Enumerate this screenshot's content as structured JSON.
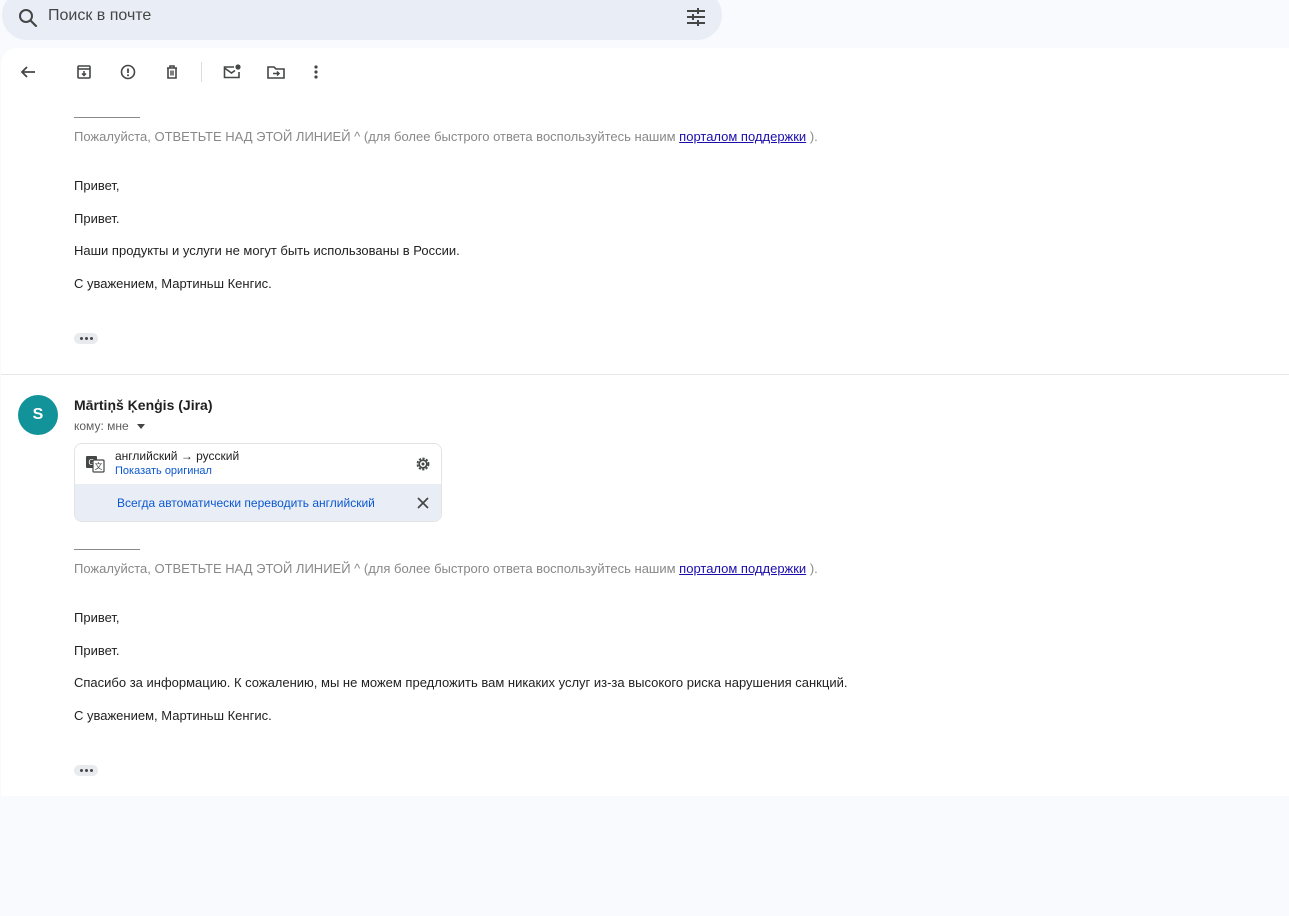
{
  "search": {
    "placeholder": "Поиск в почте"
  },
  "toolbar": {
    "back": "arrow-back-icon",
    "archive": "archive-icon",
    "spam": "report-spam-icon",
    "delete": "delete-icon",
    "mark_unread": "mark-unread-icon",
    "move": "move-to-icon",
    "more": "more-vertical-icon"
  },
  "message1": {
    "notice_prefix": "Пожалуйста, ОТВЕТЬТЕ НАД ЭТОЙ ЛИНИЕЙ ^ (для более быстрого ответа воспользуйтесь нашим ",
    "notice_link": "порталом поддержки",
    "notice_suffix": " ).",
    "lines": [
      "Привет,",
      "Привет.",
      "Наши продукты и услуги не могут быть использованы в России.",
      "С уважением, Мартиньш Кенгис."
    ]
  },
  "message2": {
    "avatar_letter": "S",
    "sender": "Mārtiņš Ķenģis (Jira)",
    "to": "кому: мне",
    "translation": {
      "langs": "английский → русский",
      "show_original": "Показать оригинал",
      "always_translate": "Всегда автоматически переводить английский"
    },
    "notice_prefix": "Пожалуйста, ОТВЕТЬТЕ НАД ЭТОЙ ЛИНИЕЙ ^ (для более быстрого ответа воспользуйтесь нашим ",
    "notice_link": "порталом поддержки",
    "notice_suffix": " ).",
    "lines": [
      "Привет,",
      "Привет.",
      "Спасибо за информацию. К сожалению, мы не можем предложить вам никаких услуг из-за высокого риска нарушения санкций.",
      "С уважением, Мартиньш Кенгис."
    ]
  },
  "colors": {
    "avatar": "#12939a",
    "link": "#0b57d0",
    "background": "#f8fafd"
  }
}
